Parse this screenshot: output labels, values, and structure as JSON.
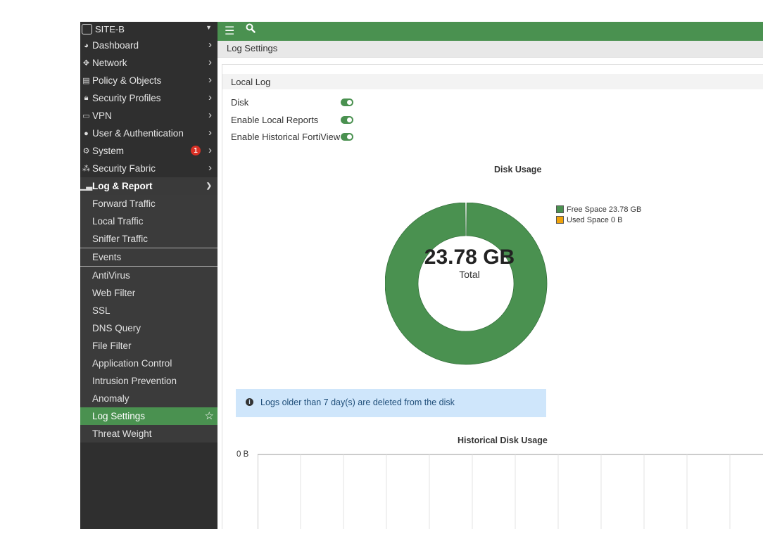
{
  "device": {
    "name": "SITE-B"
  },
  "sidebar": {
    "items": [
      {
        "label": "Dashboard",
        "icon": "dashboard-icon"
      },
      {
        "label": "Network",
        "icon": "network-icon"
      },
      {
        "label": "Policy & Objects",
        "icon": "policy-icon"
      },
      {
        "label": "Security Profiles",
        "icon": "lock-icon"
      },
      {
        "label": "VPN",
        "icon": "laptop-icon"
      },
      {
        "label": "User & Authentication",
        "icon": "user-icon"
      },
      {
        "label": "System",
        "icon": "gear-icon",
        "badge": "1"
      },
      {
        "label": "Security Fabric",
        "icon": "fabric-icon"
      },
      {
        "label": "Log & Report",
        "icon": "chart-icon"
      }
    ],
    "log_report_sub": [
      "Forward Traffic",
      "Local Traffic",
      "Sniffer Traffic",
      "Events",
      "AntiVirus",
      "Web Filter",
      "SSL",
      "DNS Query",
      "File Filter",
      "Application Control",
      "Intrusion Prevention",
      "Anomaly",
      "Log Settings",
      "Threat Weight"
    ]
  },
  "breadcrumb": {
    "title": "Log Settings"
  },
  "local_log": {
    "header": "Local Log",
    "settings": [
      {
        "label": "Disk",
        "enabled": true
      },
      {
        "label": "Enable Local Reports",
        "enabled": true
      },
      {
        "label": "Enable Historical FortiView",
        "enabled": true
      }
    ]
  },
  "disk_usage": {
    "title": "Disk Usage",
    "total_value": "23.78 GB",
    "total_label": "Total",
    "legend": [
      {
        "label": "Free Space 23.78 GB",
        "color": "#4a9150"
      },
      {
        "label": "Used Space 0 B",
        "color": "#f0a30a"
      }
    ]
  },
  "chart_data": [
    {
      "type": "pie",
      "title": "Disk Usage",
      "categories": [
        "Free Space",
        "Used Space"
      ],
      "values": [
        23.78,
        0
      ],
      "unit": "GB",
      "legend": "top-right",
      "colors": [
        "#4a9150",
        "#f0a30a"
      ]
    },
    {
      "type": "line",
      "title": "Historical Disk Usage",
      "ylabel": "",
      "y_ticks": [
        "0 B"
      ],
      "series": []
    }
  ],
  "notice": {
    "text": "Logs older than 7 day(s) are deleted from the disk"
  },
  "historical": {
    "title": "Historical Disk Usage",
    "y_tick": "0 B"
  }
}
